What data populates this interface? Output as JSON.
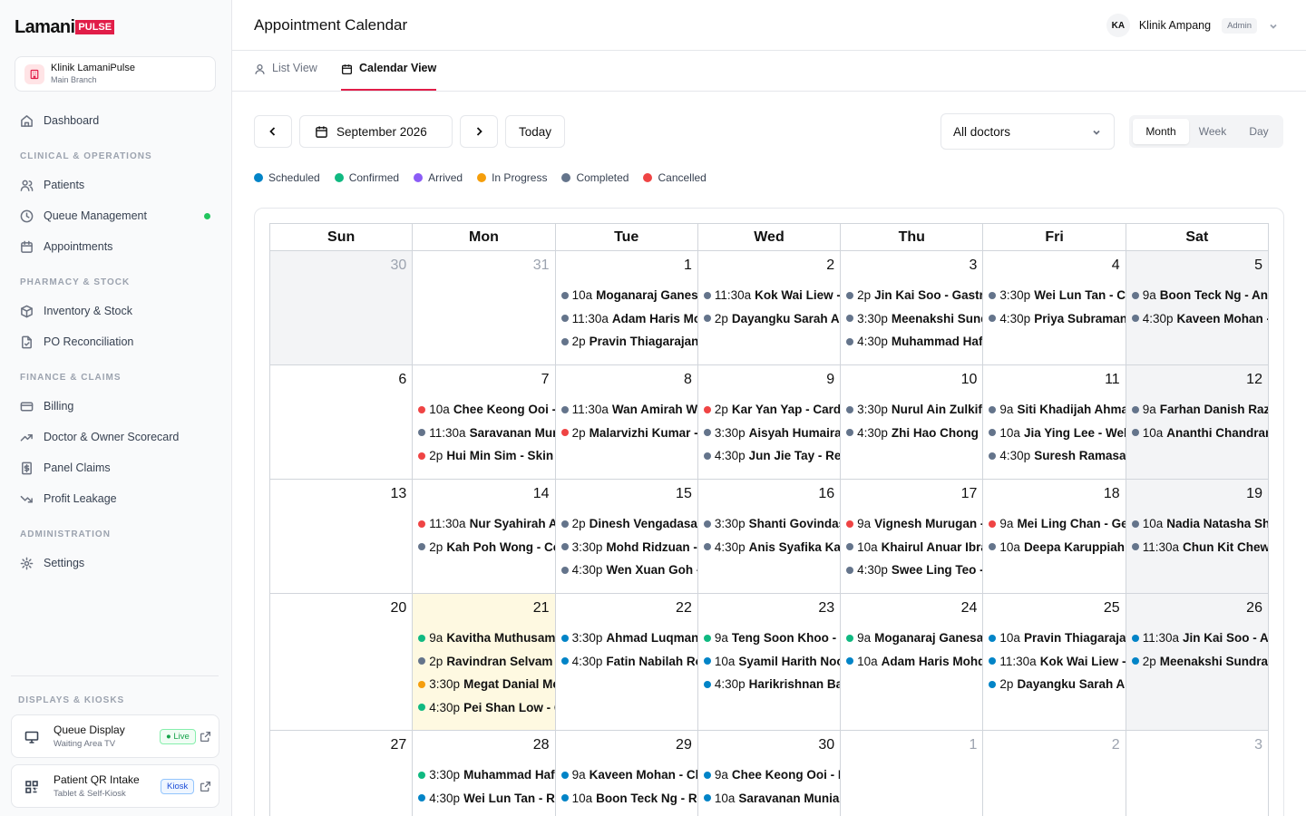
{
  "brand": {
    "name": "Lamani",
    "badge": "PULSE"
  },
  "clinic": {
    "name": "Klinik LamaniPulse",
    "branch": "Main Branch"
  },
  "nav": {
    "dashboard": "Dashboard",
    "sec_clinical": "CLINICAL & OPERATIONS",
    "patients": "Patients",
    "queue": "Queue Management",
    "appointments": "Appointments",
    "sec_pharmacy": "PHARMACY & STOCK",
    "inventory": "Inventory & Stock",
    "po": "PO Reconciliation",
    "sec_finance": "FINANCE & CLAIMS",
    "billing": "Billing",
    "scorecard": "Doctor & Owner Scorecard",
    "panel": "Panel Claims",
    "leakage": "Profit Leakage",
    "sec_admin": "ADMINISTRATION",
    "settings": "Settings",
    "sec_displays": "DISPLAYS & KIOSKS"
  },
  "kiosks": {
    "queue": {
      "title": "Queue Display",
      "sub": "Waiting Area TV",
      "badge": "● Live"
    },
    "intake": {
      "title": "Patient QR Intake",
      "sub": "Tablet & Self-Kiosk",
      "badge": "Kiosk"
    }
  },
  "header": {
    "title": "Appointment Calendar",
    "initials": "KA",
    "user": "Klinik Ampang",
    "role": "Admin"
  },
  "tabs": {
    "list": "List View",
    "calendar": "Calendar View"
  },
  "toolbar": {
    "month_label": "September 2026",
    "today": "Today",
    "doctor_filter": "All doctors",
    "views": [
      "Month",
      "Week",
      "Day"
    ]
  },
  "colors": {
    "scheduled": "#0284c7",
    "confirmed": "#10b981",
    "arrived": "#8b5cf6",
    "in_progress": "#f59e0b",
    "completed": "#64748b",
    "cancelled": "#ef4444"
  },
  "legend": [
    {
      "label": "Scheduled",
      "status": "scheduled"
    },
    {
      "label": "Confirmed",
      "status": "confirmed"
    },
    {
      "label": "Arrived",
      "status": "arrived"
    },
    {
      "label": "In Progress",
      "status": "in_progress"
    },
    {
      "label": "Completed",
      "status": "completed"
    },
    {
      "label": "Cancelled",
      "status": "cancelled"
    }
  ],
  "calendar": {
    "weekdays": [
      "Sun",
      "Mon",
      "Tue",
      "Wed",
      "Thu",
      "Fri",
      "Sat"
    ],
    "today": 21,
    "weeks": [
      [
        {
          "day": 30,
          "muted": true,
          "events": []
        },
        {
          "day": 31,
          "muted": true,
          "events": []
        },
        {
          "day": 1,
          "events": [
            {
              "time": "10a",
              "name": "Moganaraj Ganesan - General Consultation",
              "status": "completed"
            },
            {
              "time": "11:30a",
              "name": "Adam Haris Mohd - Follow-up",
              "status": "completed"
            },
            {
              "time": "2p",
              "name": "Pravin Thiagarajan - Vaccination",
              "status": "completed"
            }
          ]
        },
        {
          "day": 2,
          "events": [
            {
              "time": "11:30a",
              "name": "Kok Wai Liew - Review",
              "status": "completed"
            },
            {
              "time": "2p",
              "name": "Dayangku Sarah Abdullah - Consultation",
              "status": "completed"
            }
          ]
        },
        {
          "day": 3,
          "events": [
            {
              "time": "2p",
              "name": "Jin Kai Soo - Gastritis",
              "status": "completed"
            },
            {
              "time": "3:30p",
              "name": "Meenakshi Sundram - Follow-up",
              "status": "completed"
            },
            {
              "time": "4:30p",
              "name": "Muhammad Hafiz - Review",
              "status": "completed"
            }
          ]
        },
        {
          "day": 4,
          "events": [
            {
              "time": "3:30p",
              "name": "Wei Lun Tan - Check-up",
              "status": "completed"
            },
            {
              "time": "4:30p",
              "name": "Priya Subramaniam - Consultation",
              "status": "completed"
            }
          ]
        },
        {
          "day": 5,
          "events": [
            {
              "time": "9a",
              "name": "Boon Teck Ng - Annual Check-up",
              "status": "completed"
            },
            {
              "time": "4:30p",
              "name": "Kaveen Mohan - Review",
              "status": "completed"
            }
          ]
        }
      ],
      [
        {
          "day": 6,
          "events": []
        },
        {
          "day": 7,
          "events": [
            {
              "time": "10a",
              "name": "Chee Keong Ooi - Consultation",
              "status": "cancelled"
            },
            {
              "time": "11:30a",
              "name": "Saravanan Muniandy - Follow-up",
              "status": "completed"
            },
            {
              "time": "2p",
              "name": "Hui Min Sim - Skin Rash",
              "status": "cancelled"
            }
          ]
        },
        {
          "day": 8,
          "events": [
            {
              "time": "11:30a",
              "name": "Wan Amirah Wan Ismail - Review",
              "status": "completed"
            },
            {
              "time": "2p",
              "name": "Malarvizhi Kumar - Consultation",
              "status": "cancelled"
            }
          ]
        },
        {
          "day": 9,
          "events": [
            {
              "time": "2p",
              "name": "Kar Yan Yap - Cardiology",
              "status": "cancelled"
            },
            {
              "time": "3:30p",
              "name": "Aisyah Humaira - Follow-up",
              "status": "completed"
            },
            {
              "time": "4:30p",
              "name": "Jun Jie Tay - Review",
              "status": "completed"
            }
          ]
        },
        {
          "day": 10,
          "events": [
            {
              "time": "3:30p",
              "name": "Nurul Ain Zulkifli - Consultation",
              "status": "completed"
            },
            {
              "time": "4:30p",
              "name": "Zhi Hao Chong - Follow-up",
              "status": "completed"
            }
          ]
        },
        {
          "day": 11,
          "events": [
            {
              "time": "9a",
              "name": "Siti Khadijah Ahmad - Check-up",
              "status": "completed"
            },
            {
              "time": "10a",
              "name": "Jia Ying Lee - Wellness",
              "status": "completed"
            },
            {
              "time": "4:30p",
              "name": "Suresh Ramasamy - Review",
              "status": "completed"
            }
          ]
        },
        {
          "day": 12,
          "events": [
            {
              "time": "9a",
              "name": "Farhan Danish Razak - Consultation",
              "status": "completed"
            },
            {
              "time": "10a",
              "name": "Ananthi Chandran - Follow-up",
              "status": "completed"
            }
          ]
        }
      ],
      [
        {
          "day": 13,
          "events": []
        },
        {
          "day": 14,
          "events": [
            {
              "time": "11:30a",
              "name": "Nur Syahirah Aziz - Review",
              "status": "cancelled"
            },
            {
              "time": "2p",
              "name": "Kah Poh Wong - Consultation",
              "status": "completed"
            }
          ]
        },
        {
          "day": 15,
          "events": [
            {
              "time": "2p",
              "name": "Dinesh Vengadasalam - Follow-up",
              "status": "completed"
            },
            {
              "time": "3:30p",
              "name": "Mohd Ridzuan - Check-up",
              "status": "completed"
            },
            {
              "time": "4:30p",
              "name": "Wen Xuan Goh - Review",
              "status": "completed"
            }
          ]
        },
        {
          "day": 16,
          "events": [
            {
              "time": "3:30p",
              "name": "Shanti Govindasamy - Consultation",
              "status": "completed"
            },
            {
              "time": "4:30p",
              "name": "Anis Syafika Kamal - Follow-up",
              "status": "completed"
            }
          ]
        },
        {
          "day": 17,
          "events": [
            {
              "time": "9a",
              "name": "Vignesh Murugan - Review",
              "status": "cancelled"
            },
            {
              "time": "10a",
              "name": "Khairul Anuar Ibrahim - Check-up",
              "status": "completed"
            },
            {
              "time": "4:30p",
              "name": "Swee Ling Teo - Consultation",
              "status": "completed"
            }
          ]
        },
        {
          "day": 18,
          "events": [
            {
              "time": "9a",
              "name": "Mei Ling Chan - General",
              "status": "cancelled"
            },
            {
              "time": "10a",
              "name": "Deepa Karuppiah - Follow-up",
              "status": "completed"
            }
          ]
        },
        {
          "day": 19,
          "events": [
            {
              "time": "10a",
              "name": "Nadia Natasha Shah - Review",
              "status": "completed"
            },
            {
              "time": "11:30a",
              "name": "Chun Kit Chew - Consultation",
              "status": "completed"
            }
          ]
        }
      ],
      [
        {
          "day": 20,
          "events": []
        },
        {
          "day": 21,
          "events": [
            {
              "time": "9a",
              "name": "Kavitha Muthusamy - Consultation",
              "status": "confirmed"
            },
            {
              "time": "2p",
              "name": "Ravindran Selvam - Follow-up",
              "status": "completed"
            },
            {
              "time": "3:30p",
              "name": "Megat Danial Megat - Review",
              "status": "in_progress"
            },
            {
              "time": "4:30p",
              "name": "Pei Shan Low - Check-up",
              "status": "confirmed"
            }
          ]
        },
        {
          "day": 22,
          "events": [
            {
              "time": "3:30p",
              "name": "Ahmad Luqman Hakim - Consultation",
              "status": "scheduled"
            },
            {
              "time": "4:30p",
              "name": "Fatin Nabilah Rosli - Follow-up",
              "status": "scheduled"
            }
          ]
        },
        {
          "day": 23,
          "events": [
            {
              "time": "9a",
              "name": "Teng Soon Khoo - Review",
              "status": "confirmed"
            },
            {
              "time": "10a",
              "name": "Syamil Harith Noor - Check-up",
              "status": "scheduled"
            },
            {
              "time": "4:30p",
              "name": "Harikrishnan Balan - Consultation",
              "status": "scheduled"
            }
          ]
        },
        {
          "day": 24,
          "events": [
            {
              "time": "9a",
              "name": "Moganaraj Ganesan - Follow-up",
              "status": "confirmed"
            },
            {
              "time": "10a",
              "name": "Adam Haris Mohd - Review",
              "status": "scheduled"
            }
          ]
        },
        {
          "day": 25,
          "events": [
            {
              "time": "10a",
              "name": "Pravin Thiagarajan - Consultation",
              "status": "scheduled"
            },
            {
              "time": "11:30a",
              "name": "Kok Wai Liew - Follow-up",
              "status": "scheduled"
            },
            {
              "time": "2p",
              "name": "Dayangku Sarah Abdullah - Review",
              "status": "scheduled"
            }
          ]
        },
        {
          "day": 26,
          "events": [
            {
              "time": "11:30a",
              "name": "Jin Kai Soo - Annual Check-up",
              "status": "scheduled"
            },
            {
              "time": "2p",
              "name": "Meenakshi Sundram - Consultation",
              "status": "scheduled"
            }
          ]
        }
      ],
      [
        {
          "day": 27,
          "events": []
        },
        {
          "day": 28,
          "events": [
            {
              "time": "3:30p",
              "name": "Muhammad Hafiz - Consultation",
              "status": "confirmed"
            },
            {
              "time": "4:30p",
              "name": "Wei Lun Tan - Review",
              "status": "scheduled"
            }
          ]
        },
        {
          "day": 29,
          "events": [
            {
              "time": "9a",
              "name": "Kaveen Mohan - Check-up",
              "status": "scheduled"
            },
            {
              "time": "10a",
              "name": "Boon Teck Ng - Review",
              "status": "scheduled"
            }
          ]
        },
        {
          "day": 30,
          "events": [
            {
              "time": "9a",
              "name": "Chee Keong Ooi - Follow-up",
              "status": "scheduled"
            },
            {
              "time": "10a",
              "name": "Saravanan Muniandy - Consultation",
              "status": "scheduled"
            }
          ]
        },
        {
          "day": 1,
          "muted": true,
          "events": []
        },
        {
          "day": 2,
          "muted": true,
          "events": []
        },
        {
          "day": 3,
          "muted": true,
          "events": []
        }
      ]
    ]
  }
}
